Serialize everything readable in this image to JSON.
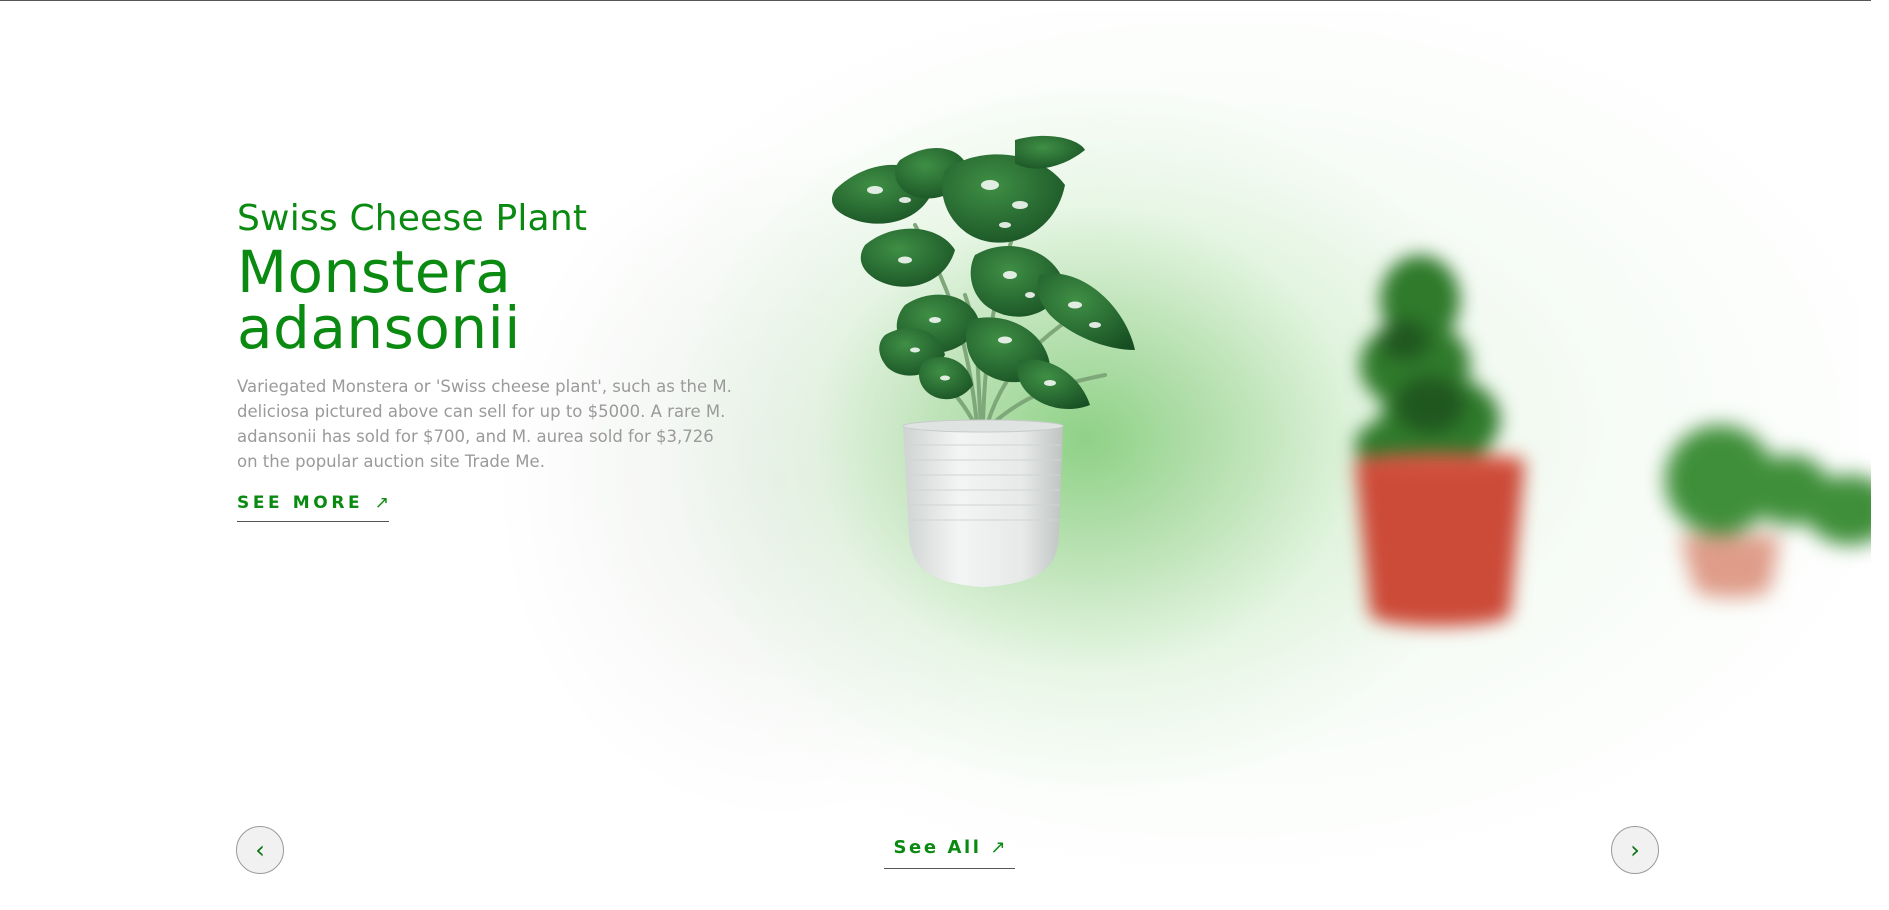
{
  "hero": {
    "subtitle": "Swiss Cheese Plant",
    "title_line1": "Monstera",
    "title_line2": "adansonii",
    "description": "Variegated Monstera or 'Swiss cheese plant', such as the M. deliciosa pictured above can sell for up to $5000. A rare M. adansonii has sold for $700, and M. aurea sold for $3,726 on the popular auction site Trade Me.",
    "see_more_label": "SEE MORE",
    "see_more_icon": "arrow-up-right-icon"
  },
  "carousel": {
    "prev_label": "‹",
    "next_label": "›",
    "see_all_label": "See All",
    "see_all_icon": "arrow-up-right-icon",
    "arrow_glyph": "↗",
    "slides": [
      {
        "name": "monstera-adansonii",
        "pot_color": "#eef0ef"
      },
      {
        "name": "potted-plant-red-pot",
        "pot_color": "#cc4a38"
      },
      {
        "name": "potted-plant-small",
        "pot_color": "#d98b74"
      }
    ]
  },
  "colors": {
    "accent_green": "#0b8a12",
    "description_gray": "#9a9a9a",
    "glow_green": "#8fd48a"
  }
}
